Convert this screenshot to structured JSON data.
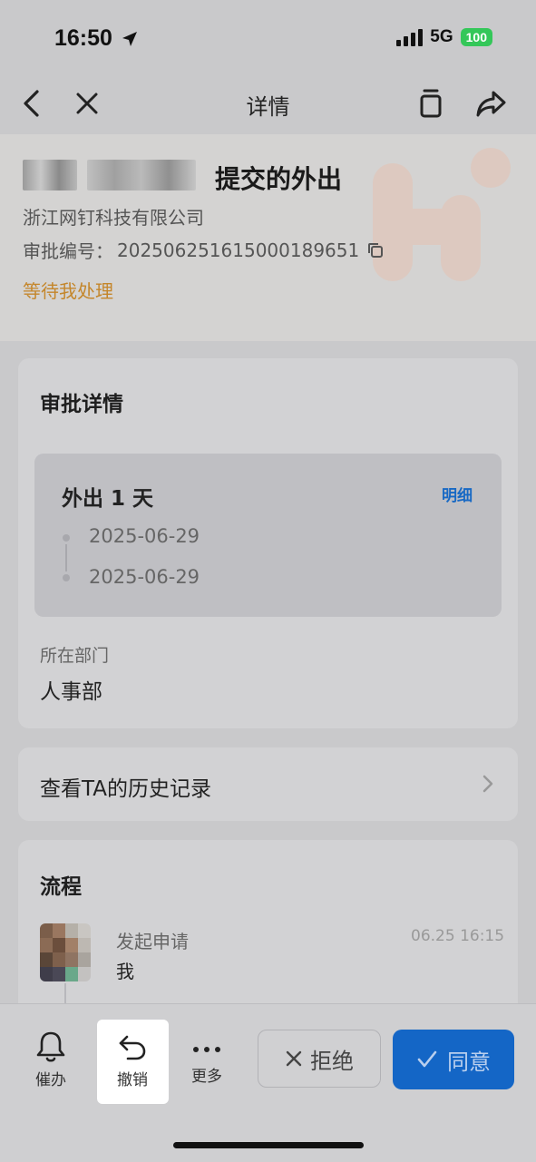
{
  "status_bar": {
    "time": "16:50",
    "network": "5G",
    "battery": "100"
  },
  "nav": {
    "title": "详情",
    "back_icon": "chevron-left-icon",
    "close_icon": "close-icon",
    "copy_icon": "copy-icon",
    "share_icon": "share-icon"
  },
  "header": {
    "title_suffix": "提交的外出",
    "company": "浙江网钉科技有限公司",
    "approval_label": "审批编号：",
    "approval_number": "202506251615000189651",
    "status": "等待我处理"
  },
  "details": {
    "title": "审批详情",
    "trip_title": "外出 1 天",
    "detail_link": "明细",
    "start_date": "2025-06-29",
    "end_date": "2025-06-29",
    "dept_label": "所在部门",
    "dept_value": "人事部"
  },
  "history": {
    "label": "查看TA的历史记录"
  },
  "flow": {
    "title": "流程",
    "action": "发起申请",
    "user": "我",
    "time": "06.25 16:15"
  },
  "bottom": {
    "remind_label": "催办",
    "undo_label": "撤销",
    "more_label": "更多",
    "reject_label": "拒绝",
    "agree_label": "同意"
  },
  "colors": {
    "accent": "#1466c6",
    "status": "#c4862b",
    "battery": "#34c759"
  }
}
